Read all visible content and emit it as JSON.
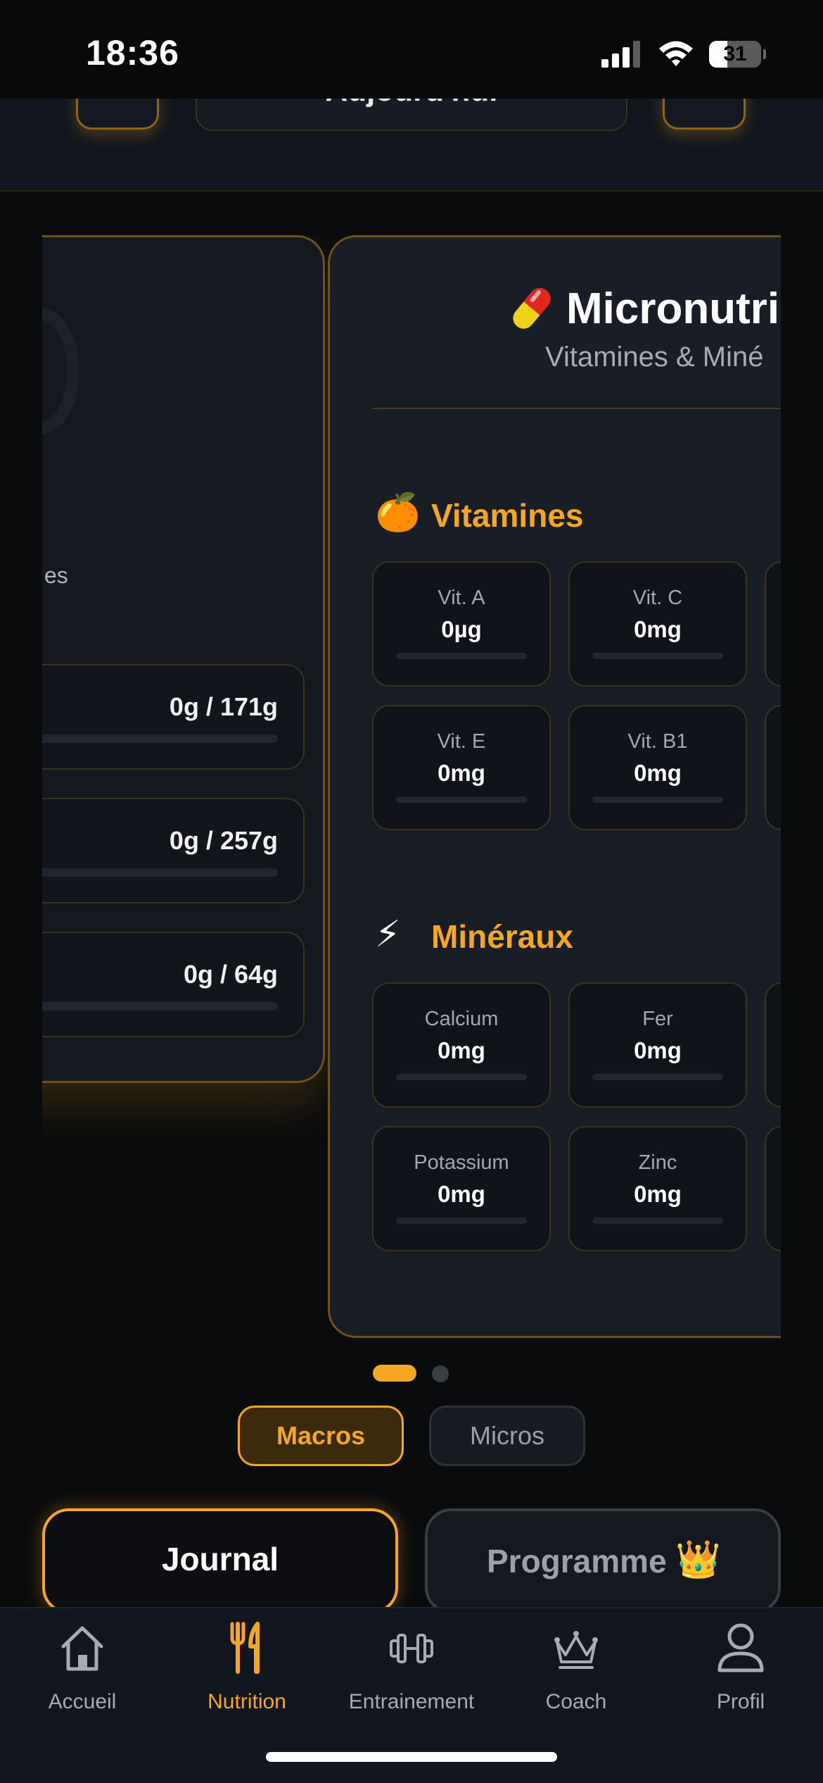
{
  "status_bar": {
    "time": "18:36",
    "battery": "31"
  },
  "date_nav": {
    "label": "Aujourd'hui"
  },
  "macros_card": {
    "ring_label": "es",
    "rows": [
      {
        "value": "0g / 171g"
      },
      {
        "value": "0g / 257g"
      },
      {
        "value": "0g / 64g"
      }
    ]
  },
  "micros_card": {
    "icon": "pill-icon",
    "title": "Micronutrir",
    "subtitle": "Vitamines & Miné",
    "vitamins": {
      "emoji": "🍊",
      "title": "Vitamines",
      "items": [
        {
          "name": "Vit. A",
          "value": "0µg"
        },
        {
          "name": "Vit. C",
          "value": "0mg"
        },
        {
          "name": "Vit. E",
          "value": "0mg"
        },
        {
          "name": "Vit. B1",
          "value": "0mg"
        }
      ]
    },
    "minerals": {
      "emoji": "⚡",
      "title": "Minéraux",
      "items": [
        {
          "name": "Calcium",
          "value": "0mg"
        },
        {
          "name": "Fer",
          "value": "0mg"
        },
        {
          "name": "Potassium",
          "value": "0mg"
        },
        {
          "name": "Zinc",
          "value": "0mg"
        }
      ]
    }
  },
  "toggle": {
    "macros": "Macros",
    "micros": "Micros"
  },
  "mode_buttons": {
    "journal": "Journal",
    "programme": "Programme",
    "programme_emoji": "👑"
  },
  "tabs": [
    {
      "label": "Accueil",
      "icon": "home-icon"
    },
    {
      "label": "Nutrition",
      "icon": "fork-knife-icon",
      "active": true
    },
    {
      "label": "Entrainement",
      "icon": "dumbbell-icon"
    },
    {
      "label": "Coach",
      "icon": "crown-icon"
    },
    {
      "label": "Profil",
      "icon": "user-icon"
    }
  ],
  "colors": {
    "accent": "#f5a623",
    "background": "#0a0b0d",
    "card": "#191d25"
  }
}
